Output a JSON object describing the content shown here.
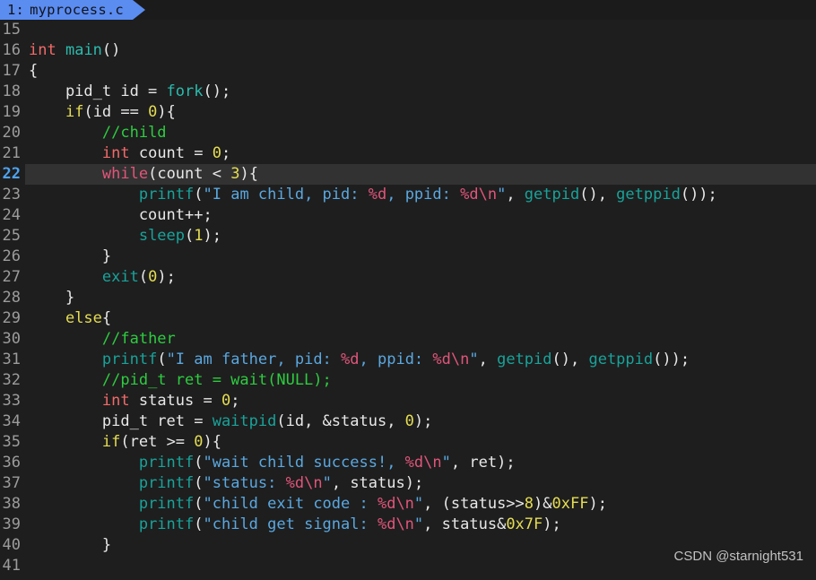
{
  "tab": {
    "index": "1:",
    "filename": "myprocess.c",
    "background": "#5b8cf0",
    "text_color": "#11131b"
  },
  "editor": {
    "background": "#1e1e1e",
    "current_line": 22,
    "current_line_highlight": "#323232",
    "gutter_color": "#9c9c9c",
    "current_gutter_color": "#4ea3f0",
    "first_visible_line": 15,
    "last_visible_line": 41,
    "lines": [
      {
        "n": "15",
        "tokens": []
      },
      {
        "n": "16",
        "tokens": [
          {
            "c": "t-type",
            "t": "int"
          },
          {
            "c": "t-plain",
            "t": " "
          },
          {
            "c": "t-fn2",
            "t": "main"
          },
          {
            "c": "t-punc",
            "t": "()"
          }
        ]
      },
      {
        "n": "17",
        "tokens": [
          {
            "c": "t-punc",
            "t": "{"
          }
        ]
      },
      {
        "n": "18",
        "tokens": [
          {
            "c": "t-plain",
            "t": "    pid_t id = "
          },
          {
            "c": "t-fn2",
            "t": "fork"
          },
          {
            "c": "t-punc",
            "t": "();"
          }
        ]
      },
      {
        "n": "19",
        "tokens": [
          {
            "c": "t-plain",
            "t": "    "
          },
          {
            "c": "t-kw",
            "t": "if"
          },
          {
            "c": "t-punc",
            "t": "("
          },
          {
            "c": "t-plain",
            "t": "id == "
          },
          {
            "c": "t-num",
            "t": "0"
          },
          {
            "c": "t-punc",
            "t": "){"
          }
        ]
      },
      {
        "n": "20",
        "tokens": [
          {
            "c": "t-plain",
            "t": "        "
          },
          {
            "c": "t-cmt",
            "t": "//child"
          }
        ]
      },
      {
        "n": "21",
        "tokens": [
          {
            "c": "t-plain",
            "t": "        "
          },
          {
            "c": "t-type",
            "t": "int"
          },
          {
            "c": "t-plain",
            "t": " count = "
          },
          {
            "c": "t-num",
            "t": "0"
          },
          {
            "c": "t-punc",
            "t": ";"
          }
        ]
      },
      {
        "n": "22",
        "current": true,
        "tokens": [
          {
            "c": "t-plain",
            "t": "        "
          },
          {
            "c": "t-ctrl",
            "t": "while"
          },
          {
            "c": "t-punc",
            "t": "("
          },
          {
            "c": "t-plain",
            "t": "count < "
          },
          {
            "c": "t-num",
            "t": "3"
          },
          {
            "c": "t-punc",
            "t": "){"
          }
        ]
      },
      {
        "n": "23",
        "tokens": [
          {
            "c": "t-plain",
            "t": "            "
          },
          {
            "c": "t-fn",
            "t": "printf"
          },
          {
            "c": "t-punc",
            "t": "("
          },
          {
            "c": "t-str",
            "t": "\"I am child, pid: "
          },
          {
            "c": "t-fmt",
            "t": "%d"
          },
          {
            "c": "t-str",
            "t": ", ppid: "
          },
          {
            "c": "t-fmt",
            "t": "%d\\n"
          },
          {
            "c": "t-str",
            "t": "\""
          },
          {
            "c": "t-punc",
            "t": ", "
          },
          {
            "c": "t-fn",
            "t": "getpid"
          },
          {
            "c": "t-punc",
            "t": "(), "
          },
          {
            "c": "t-fn",
            "t": "getppid"
          },
          {
            "c": "t-punc",
            "t": "());"
          }
        ]
      },
      {
        "n": "24",
        "tokens": [
          {
            "c": "t-plain",
            "t": "            count++;"
          }
        ]
      },
      {
        "n": "25",
        "tokens": [
          {
            "c": "t-plain",
            "t": "            "
          },
          {
            "c": "t-fn",
            "t": "sleep"
          },
          {
            "c": "t-punc",
            "t": "("
          },
          {
            "c": "t-num",
            "t": "1"
          },
          {
            "c": "t-punc",
            "t": ");"
          }
        ]
      },
      {
        "n": "26",
        "tokens": [
          {
            "c": "t-plain",
            "t": "        }"
          }
        ]
      },
      {
        "n": "27",
        "tokens": [
          {
            "c": "t-plain",
            "t": "        "
          },
          {
            "c": "t-fn",
            "t": "exit"
          },
          {
            "c": "t-punc",
            "t": "("
          },
          {
            "c": "t-num",
            "t": "0"
          },
          {
            "c": "t-punc",
            "t": ");"
          }
        ]
      },
      {
        "n": "28",
        "tokens": [
          {
            "c": "t-plain",
            "t": "    }"
          }
        ]
      },
      {
        "n": "29",
        "tokens": [
          {
            "c": "t-plain",
            "t": "    "
          },
          {
            "c": "t-kw",
            "t": "else"
          },
          {
            "c": "t-punc",
            "t": "{"
          }
        ]
      },
      {
        "n": "30",
        "tokens": [
          {
            "c": "t-plain",
            "t": "        "
          },
          {
            "c": "t-cmt",
            "t": "//father"
          }
        ]
      },
      {
        "n": "31",
        "tokens": [
          {
            "c": "t-plain",
            "t": "        "
          },
          {
            "c": "t-fn",
            "t": "printf"
          },
          {
            "c": "t-punc",
            "t": "("
          },
          {
            "c": "t-str",
            "t": "\"I am father, pid: "
          },
          {
            "c": "t-fmt",
            "t": "%d"
          },
          {
            "c": "t-str",
            "t": ", ppid: "
          },
          {
            "c": "t-fmt",
            "t": "%d\\n"
          },
          {
            "c": "t-str",
            "t": "\""
          },
          {
            "c": "t-punc",
            "t": ", "
          },
          {
            "c": "t-fn",
            "t": "getpid"
          },
          {
            "c": "t-punc",
            "t": "(), "
          },
          {
            "c": "t-fn",
            "t": "getppid"
          },
          {
            "c": "t-punc",
            "t": "());"
          }
        ]
      },
      {
        "n": "32",
        "tokens": [
          {
            "c": "t-plain",
            "t": "        "
          },
          {
            "c": "t-cmt",
            "t": "//pid_t ret = wait(NULL);"
          }
        ]
      },
      {
        "n": "33",
        "tokens": [
          {
            "c": "t-plain",
            "t": "        "
          },
          {
            "c": "t-type",
            "t": "int"
          },
          {
            "c": "t-plain",
            "t": " status = "
          },
          {
            "c": "t-num",
            "t": "0"
          },
          {
            "c": "t-punc",
            "t": ";"
          }
        ]
      },
      {
        "n": "34",
        "tokens": [
          {
            "c": "t-plain",
            "t": "        pid_t ret = "
          },
          {
            "c": "t-fn",
            "t": "waitpid"
          },
          {
            "c": "t-punc",
            "t": "("
          },
          {
            "c": "t-plain",
            "t": "id, &status, "
          },
          {
            "c": "t-num",
            "t": "0"
          },
          {
            "c": "t-punc",
            "t": ");"
          }
        ]
      },
      {
        "n": "35",
        "tokens": [
          {
            "c": "t-plain",
            "t": "        "
          },
          {
            "c": "t-kw",
            "t": "if"
          },
          {
            "c": "t-punc",
            "t": "("
          },
          {
            "c": "t-plain",
            "t": "ret >= "
          },
          {
            "c": "t-num",
            "t": "0"
          },
          {
            "c": "t-punc",
            "t": "){"
          }
        ]
      },
      {
        "n": "36",
        "tokens": [
          {
            "c": "t-plain",
            "t": "            "
          },
          {
            "c": "t-fn",
            "t": "printf"
          },
          {
            "c": "t-punc",
            "t": "("
          },
          {
            "c": "t-str",
            "t": "\"wait child success!, "
          },
          {
            "c": "t-fmt",
            "t": "%d\\n"
          },
          {
            "c": "t-str",
            "t": "\""
          },
          {
            "c": "t-punc",
            "t": ", "
          },
          {
            "c": "t-plain",
            "t": "ret"
          },
          {
            "c": "t-punc",
            "t": ");"
          }
        ]
      },
      {
        "n": "37",
        "tokens": [
          {
            "c": "t-plain",
            "t": "            "
          },
          {
            "c": "t-fn",
            "t": "printf"
          },
          {
            "c": "t-punc",
            "t": "("
          },
          {
            "c": "t-str",
            "t": "\"status: "
          },
          {
            "c": "t-fmt",
            "t": "%d\\n"
          },
          {
            "c": "t-str",
            "t": "\""
          },
          {
            "c": "t-punc",
            "t": ", "
          },
          {
            "c": "t-plain",
            "t": "status"
          },
          {
            "c": "t-punc",
            "t": ");"
          }
        ]
      },
      {
        "n": "38",
        "tokens": [
          {
            "c": "t-plain",
            "t": "            "
          },
          {
            "c": "t-fn",
            "t": "printf"
          },
          {
            "c": "t-punc",
            "t": "("
          },
          {
            "c": "t-str",
            "t": "\"child exit code : "
          },
          {
            "c": "t-fmt",
            "t": "%d\\n"
          },
          {
            "c": "t-str",
            "t": "\""
          },
          {
            "c": "t-punc",
            "t": ", ("
          },
          {
            "c": "t-plain",
            "t": "status>>"
          },
          {
            "c": "t-num",
            "t": "8"
          },
          {
            "c": "t-punc",
            "t": ")&"
          },
          {
            "c": "t-num",
            "t": "0xFF"
          },
          {
            "c": "t-punc",
            "t": ");"
          }
        ]
      },
      {
        "n": "39",
        "tokens": [
          {
            "c": "t-plain",
            "t": "            "
          },
          {
            "c": "t-fn",
            "t": "printf"
          },
          {
            "c": "t-punc",
            "t": "("
          },
          {
            "c": "t-str",
            "t": "\"child get signal: "
          },
          {
            "c": "t-fmt",
            "t": "%d\\n"
          },
          {
            "c": "t-str",
            "t": "\""
          },
          {
            "c": "t-punc",
            "t": ", "
          },
          {
            "c": "t-plain",
            "t": "status&"
          },
          {
            "c": "t-num",
            "t": "0x7F"
          },
          {
            "c": "t-punc",
            "t": ");"
          }
        ]
      },
      {
        "n": "40",
        "tokens": [
          {
            "c": "t-plain",
            "t": "        }"
          }
        ]
      },
      {
        "n": "41",
        "tokens": []
      }
    ]
  },
  "watermark": {
    "text": "CSDN @starnight531"
  }
}
